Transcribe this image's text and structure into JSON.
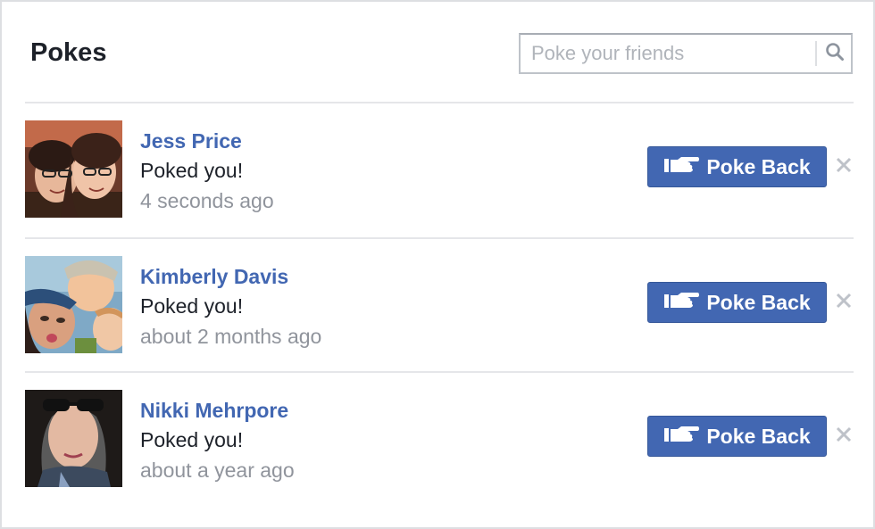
{
  "title": "Pokes",
  "search": {
    "placeholder": "Poke your friends",
    "value": "",
    "icon": "search-icon"
  },
  "pokes": [
    {
      "name": "Jess Price",
      "status": "Poked you!",
      "time": "4 seconds ago",
      "button_label": "Poke Back",
      "button_icon": "poke-hand-icon",
      "dismiss_icon": "close-icon"
    },
    {
      "name": "Kimberly Davis",
      "status": "Poked you!",
      "time": "about 2 months ago",
      "button_label": "Poke Back",
      "button_icon": "poke-hand-icon",
      "dismiss_icon": "close-icon"
    },
    {
      "name": "Nikki Mehrpore",
      "status": "Poked you!",
      "time": "about a year ago",
      "button_label": "Poke Back",
      "button_icon": "poke-hand-icon",
      "dismiss_icon": "close-icon"
    }
  ],
  "colors": {
    "brand_blue": "#4267b2",
    "text_dark": "#1d2129",
    "text_muted": "#90949c",
    "divider": "#e5e6e9"
  }
}
